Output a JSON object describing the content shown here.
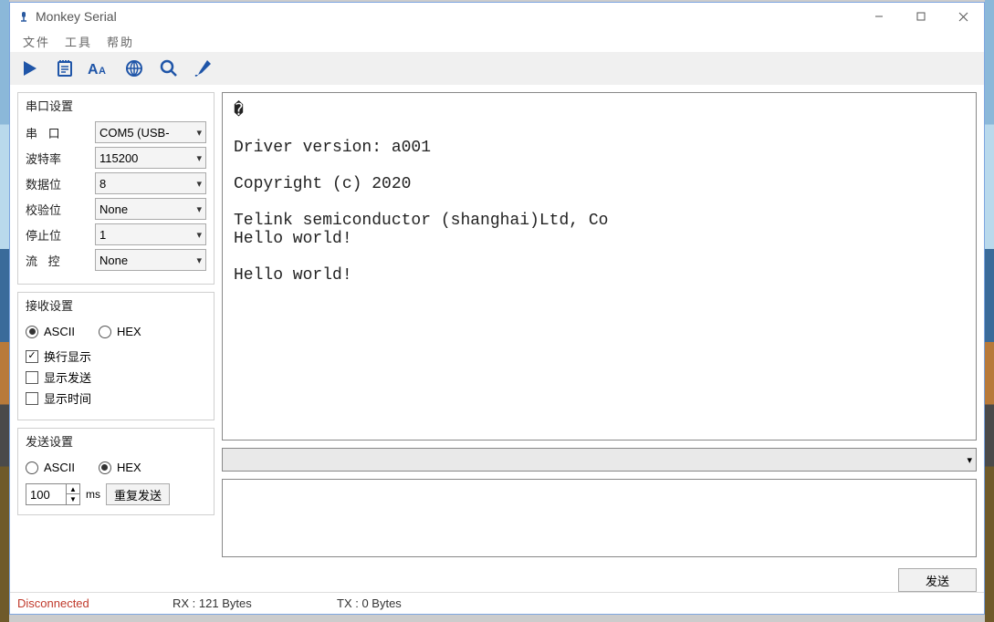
{
  "window": {
    "title": "Monkey Serial"
  },
  "menu": {
    "file": "文件",
    "tools": "工具",
    "help": "帮助"
  },
  "toolbar": {
    "icons": [
      "play-icon",
      "notepad-icon",
      "font-icon",
      "globe-icon",
      "search-icon",
      "brush-icon"
    ]
  },
  "port_settings": {
    "title": "串口设置",
    "labels": {
      "port": "串  口",
      "baud": "波特率",
      "data": "数据位",
      "parity": "校验位",
      "stop": "停止位",
      "flow": "流  控"
    },
    "values": {
      "port": "COM5 (USB-",
      "baud": "115200",
      "data": "8",
      "parity": "None",
      "stop": "1",
      "flow": "None"
    }
  },
  "recv_settings": {
    "title": "接收设置",
    "ascii": "ASCII",
    "hex": "HEX",
    "wrap": "换行显示",
    "show_send": "显示发送",
    "show_time": "显示时间",
    "selected_mode": "ascii",
    "wrap_checked": true,
    "show_send_checked": false,
    "show_time_checked": false
  },
  "send_settings": {
    "title": "发送设置",
    "ascii": "ASCII",
    "hex": "HEX",
    "selected_mode": "hex",
    "interval_value": "100",
    "interval_unit": "ms",
    "repeat_btn": "重复发送"
  },
  "terminal": {
    "content": "�\n\nDriver version: a001\n\nCopyright (c) 2020\n\nTelink semiconductor (shanghai)Ltd, Co\nHello world!\n\nHello world!"
  },
  "send_area": {
    "button": "发送"
  },
  "status": {
    "connection": "Disconnected",
    "rx": "RX : 121 Bytes",
    "tx": "TX : 0 Bytes"
  }
}
